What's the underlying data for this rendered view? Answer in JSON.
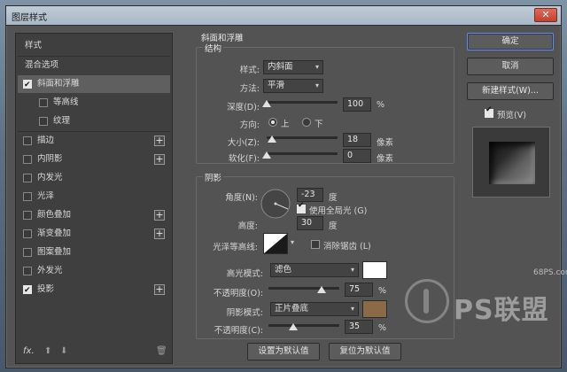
{
  "dialog": {
    "title": "图层样式",
    "close_label": "✕"
  },
  "left_panel": {
    "items": [
      {
        "label": "样式"
      },
      {
        "label": "混合选项"
      },
      {
        "label": "斜面和浮雕",
        "checked": true
      },
      {
        "label": "等高线",
        "checked": false
      },
      {
        "label": "纹理",
        "checked": false
      },
      {
        "label": "描边",
        "checked": false,
        "plus": "+"
      },
      {
        "label": "内阴影",
        "checked": false,
        "plus": "+"
      },
      {
        "label": "内发光",
        "checked": false
      },
      {
        "label": "光泽",
        "checked": false
      },
      {
        "label": "颜色叠加",
        "checked": false,
        "plus": "+"
      },
      {
        "label": "渐变叠加",
        "checked": false,
        "plus": "+"
      },
      {
        "label": "图案叠加",
        "checked": false
      },
      {
        "label": "外发光",
        "checked": false
      },
      {
        "label": "投影",
        "checked": true,
        "plus": "+"
      }
    ],
    "footer": {
      "fx": "fx.",
      "up": "⬆",
      "down": "⬇",
      "trash": "🗑"
    }
  },
  "bevel": {
    "section_title": "斜面和浮雕",
    "structure_title": "结构",
    "style": {
      "label": "样式:",
      "value": "内斜面"
    },
    "technique": {
      "label": "方法:",
      "value": "平滑"
    },
    "depth": {
      "label": "深度(D):",
      "value": "100",
      "unit": "%",
      "level": 0.0
    },
    "direction": {
      "label": "方向:",
      "up": "上",
      "down": "下",
      "selected": "up"
    },
    "size": {
      "label": "大小(Z):",
      "value": "18",
      "unit": "像素",
      "level": 0.07
    },
    "soften": {
      "label": "软化(F):",
      "value": "0",
      "unit": "像素",
      "level": 0.0
    }
  },
  "shading": {
    "title": "阴影",
    "angle": {
      "label": "角度(N):",
      "value": "-23",
      "unit": "度"
    },
    "global_light": {
      "label": "使用全局光 (G)",
      "checked": true
    },
    "altitude": {
      "label": "高度:",
      "value": "30",
      "unit": "度"
    },
    "gloss_contour": {
      "label": "光泽等高线:"
    },
    "anti_aliased": {
      "label": "消除锯齿 (L)",
      "checked": false
    },
    "highlight_mode": {
      "label": "高光模式:",
      "value": "滤色",
      "color": "#ffffff"
    },
    "highlight_opacity": {
      "label": "不透明度(O):",
      "value": "75",
      "unit": "%",
      "level": 0.75
    },
    "shadow_mode": {
      "label": "阴影模式:",
      "value": "正片叠底",
      "color": "#8a6a47"
    },
    "shadow_opacity": {
      "label": "不透明度(C):",
      "value": "35",
      "unit": "%",
      "level": 0.35
    }
  },
  "bottom_buttons": {
    "make_default": "设置为默认值",
    "reset_default": "复位为默认值"
  },
  "right": {
    "ok": "确定",
    "cancel": "取消",
    "new_style": "新建样式(W)...",
    "preview": {
      "label": "预览(V)",
      "checked": true
    }
  },
  "watermark": {
    "site": "68PS.com",
    "brand": "PS联盟"
  }
}
